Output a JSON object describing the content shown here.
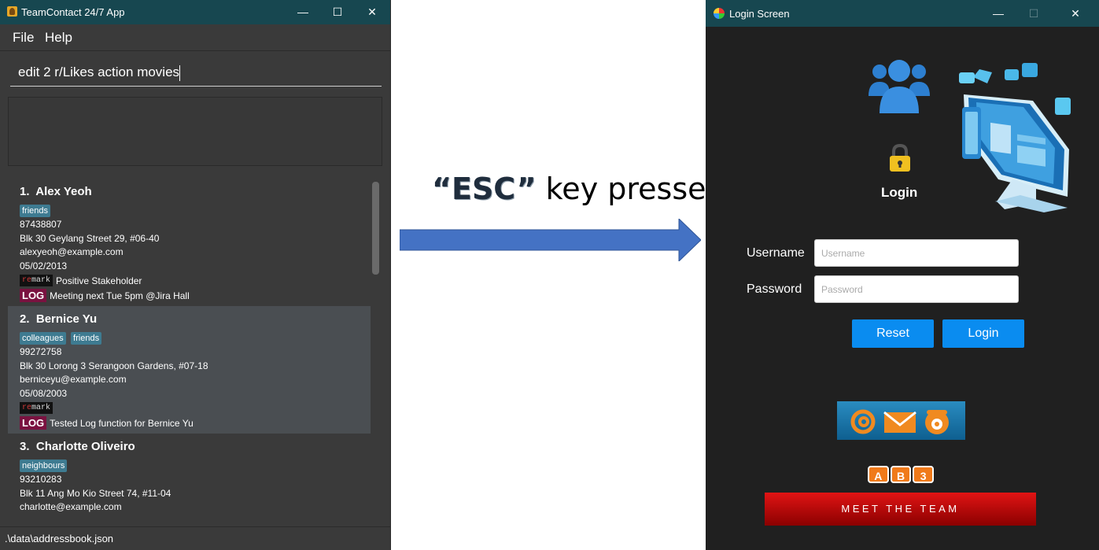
{
  "left_window": {
    "title": "TeamContact 24/7 App",
    "controls": {
      "minimize": "—",
      "maximize": "☐",
      "close": "✕"
    },
    "menu": [
      "File",
      "Help"
    ],
    "command_text": "edit 2 r/Likes action movies",
    "persons": [
      {
        "index": "1.",
        "name": "Alex Yeoh",
        "tags": [
          "friends"
        ],
        "phone": "87438807",
        "address": "Blk 30 Geylang Street 29, #06-40",
        "email": "alexyeoh@example.com",
        "birthday": "05/02/2013",
        "remark": "Positive Stakeholder",
        "log": "Meeting next Tue 5pm @Jira Hall"
      },
      {
        "index": "2.",
        "name": "Bernice Yu",
        "tags": [
          "colleagues",
          "friends"
        ],
        "phone": "99272758",
        "address": "Blk 30 Lorong 3 Serangoon Gardens, #07-18",
        "email": "berniceyu@example.com",
        "birthday": "05/08/2003",
        "remark": "",
        "log": "Tested Log function for Bernice Yu"
      },
      {
        "index": "3.",
        "name": "Charlotte Oliveiro",
        "tags": [
          "neighbours"
        ],
        "phone": "93210283",
        "address": "Blk 11 Ang Mo Kio Street 74, #11-04",
        "email": "charlotte@example.com",
        "birthday": "",
        "remark": "",
        "log": ""
      }
    ],
    "remark_badge": {
      "first": "re",
      "rest": "mark"
    },
    "log_badge": "LOG",
    "status_path": ".\\data\\addressbook.json"
  },
  "middle": {
    "esc_open": "“",
    "esc_key": "ESC",
    "esc_close": "”",
    "esc_rest": " key pressed"
  },
  "right_window": {
    "title": "Login Screen",
    "controls": {
      "minimize": "—",
      "maximize": "☐",
      "close": "✕"
    },
    "heading": "Login",
    "username_label": "Username",
    "username_placeholder": "Username",
    "password_label": "Password",
    "password_placeholder": "Password",
    "reset_label": "Reset",
    "login_label": "Login",
    "ab3_letters": [
      "A",
      "B",
      "3"
    ],
    "meet_team_label": "MEET THE TEAM"
  },
  "colors": {
    "title_bar": "#174750",
    "accent_blue": "#0a8cf0",
    "tag": "#3e7b91",
    "log_badge": "#7a1240",
    "arrow": "#4472c4",
    "meet_team_red": "#e11414"
  }
}
